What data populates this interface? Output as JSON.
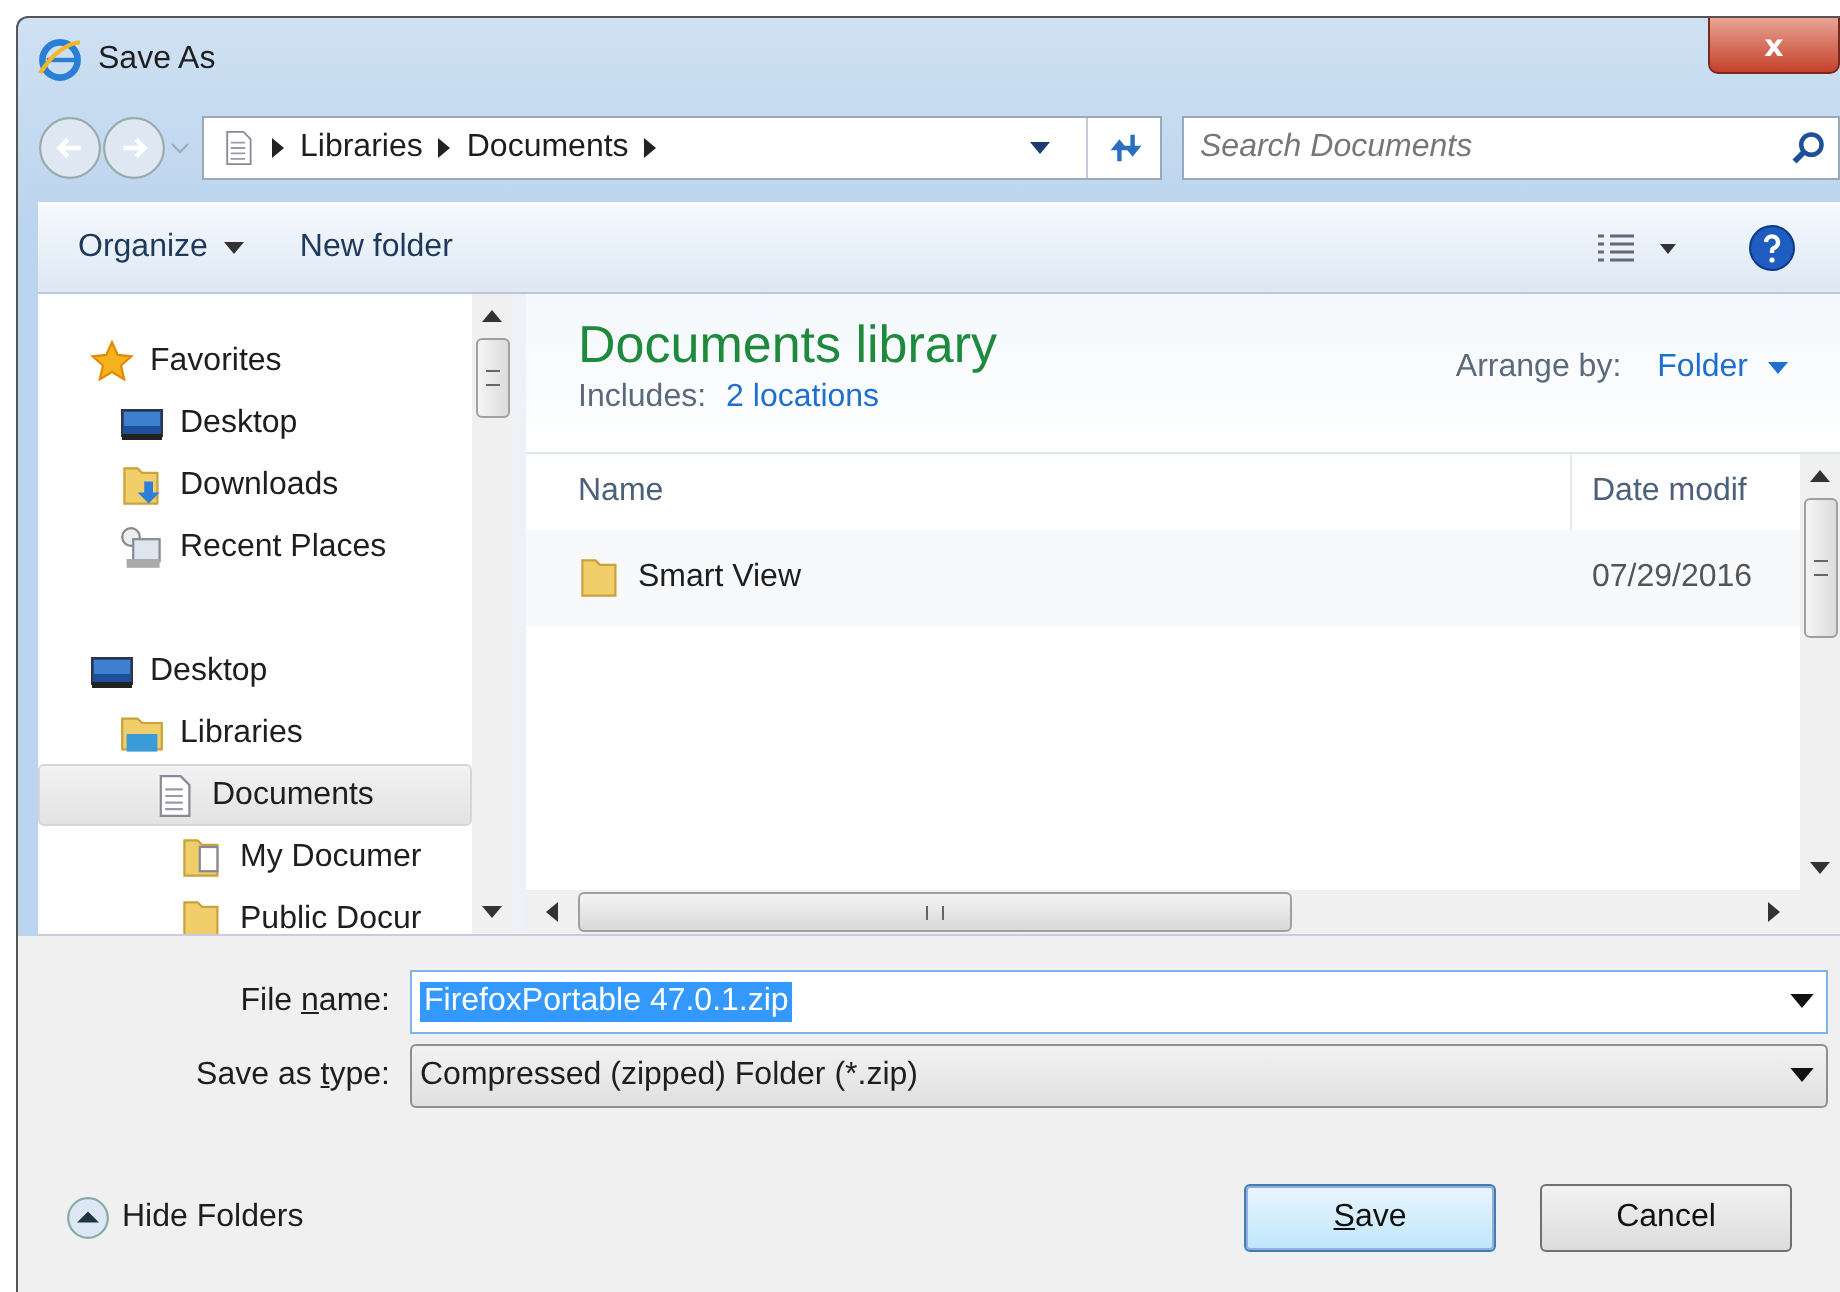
{
  "window": {
    "title": "Save As",
    "close_glyph": "x"
  },
  "address_bar": {
    "crumbs": [
      "Libraries",
      "Documents"
    ]
  },
  "search": {
    "placeholder": "Search Documents"
  },
  "toolbar": {
    "organize": "Organize",
    "new_folder": "New folder"
  },
  "nav_tree": [
    {
      "label": "Favorites",
      "kind": "star",
      "selected": false,
      "children": [
        {
          "label": "Desktop",
          "kind": "desktop",
          "selected": false
        },
        {
          "label": "Downloads",
          "kind": "downloads",
          "selected": false
        },
        {
          "label": "Recent Places",
          "kind": "recent",
          "selected": false
        }
      ]
    },
    {
      "label": "Desktop",
      "kind": "desktop",
      "selected": false,
      "children": [
        {
          "label": "Libraries",
          "kind": "libraries",
          "selected": false,
          "children": [
            {
              "label": "Documents",
              "kind": "document",
              "selected": true,
              "children": [
                {
                  "label": "My Documer",
                  "kind": "folder-doc",
                  "selected": false
                },
                {
                  "label": "Public Docur",
                  "kind": "folder",
                  "selected": false
                }
              ]
            }
          ]
        }
      ]
    }
  ],
  "library": {
    "title": "Documents library",
    "includes_label": "Includes:",
    "includes_link": "2 locations",
    "arrange_label": "Arrange by:",
    "arrange_value": "Folder"
  },
  "table": {
    "columns": [
      "Name",
      "Date modif"
    ],
    "rows": [
      {
        "name": "Smart View",
        "date": "07/29/2016",
        "kind": "folder"
      }
    ]
  },
  "file_name": {
    "label": {
      "before": "File ",
      "key": "n",
      "after": "ame:"
    },
    "value": "FirefoxPortable 47.0.1.zip",
    "selected_text": true
  },
  "save_type": {
    "label": {
      "before": "Save as ",
      "key": "t",
      "after": "ype:"
    },
    "value": "Compressed (zipped) Folder (*.zip)"
  },
  "hide_folders": "Hide Folders",
  "buttons": [
    {
      "label": {
        "key": "S",
        "after": "ave"
      },
      "kind": "default"
    },
    {
      "label": {
        "before": "Cancel"
      },
      "kind": "normal"
    }
  ]
}
